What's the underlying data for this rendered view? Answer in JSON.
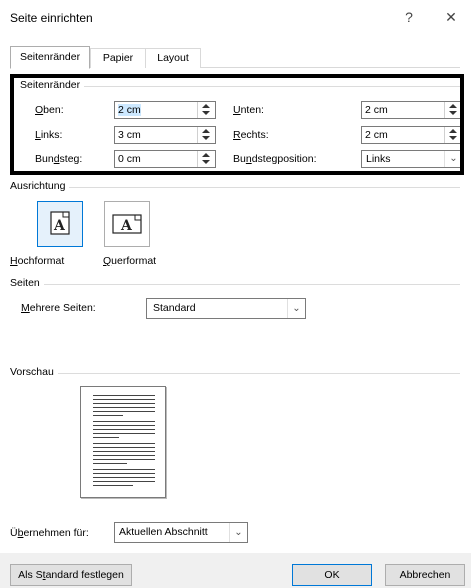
{
  "window": {
    "title": "Seite einrichten",
    "help_label": "?",
    "close_label": "✕"
  },
  "tabs": [
    {
      "label": "Seitenränder",
      "active": true
    },
    {
      "label": "Papier",
      "active": false
    },
    {
      "label": "Layout",
      "active": false
    }
  ],
  "margins": {
    "group_label": "Seitenränder",
    "top": {
      "label_pre": "",
      "label_u": "O",
      "label_post": "ben:",
      "value": "2 cm"
    },
    "bottom": {
      "label_pre": "",
      "label_u": "U",
      "label_post": "nten:",
      "value": "2 cm"
    },
    "left": {
      "label_pre": "",
      "label_u": "L",
      "label_post": "inks:",
      "value": "3 cm"
    },
    "right": {
      "label_pre": "",
      "label_u": "R",
      "label_post": "echts:",
      "value": "2 cm"
    },
    "gutter": {
      "label_pre": "Bun",
      "label_u": "d",
      "label_post": "steg:",
      "value": "0 cm"
    },
    "gutter_position": {
      "label_pre": "Bu",
      "label_u": "n",
      "label_post": "dstegposition:",
      "value": "Links"
    }
  },
  "orientation": {
    "group_label": "Ausrichtung",
    "portrait": {
      "label_pre": "",
      "label_u": "H",
      "label_post": "ochformat",
      "icon_text": "A"
    },
    "landscape": {
      "label_pre": "",
      "label_u": "Q",
      "label_post": "uerformat",
      "icon_text": "A"
    }
  },
  "pages": {
    "group_label": "Seiten",
    "multiple": {
      "label_pre": "",
      "label_u": "M",
      "label_post": "ehrere Seiten:",
      "value": "Standard"
    }
  },
  "preview": {
    "group_label": "Vorschau"
  },
  "apply_to": {
    "label_pre": "Ü",
    "label_u": "b",
    "label_post": "ernehmen für:",
    "value": "Aktuellen Abschnitt"
  },
  "buttons": {
    "default_pre": "Als S",
    "default_u": "t",
    "default_post": "andard festlegen",
    "ok": "OK",
    "cancel": "Abbrechen"
  },
  "colors": {
    "accent": "#0078d7",
    "selection": "#cce8ff",
    "footer": "#f0f0f0"
  }
}
